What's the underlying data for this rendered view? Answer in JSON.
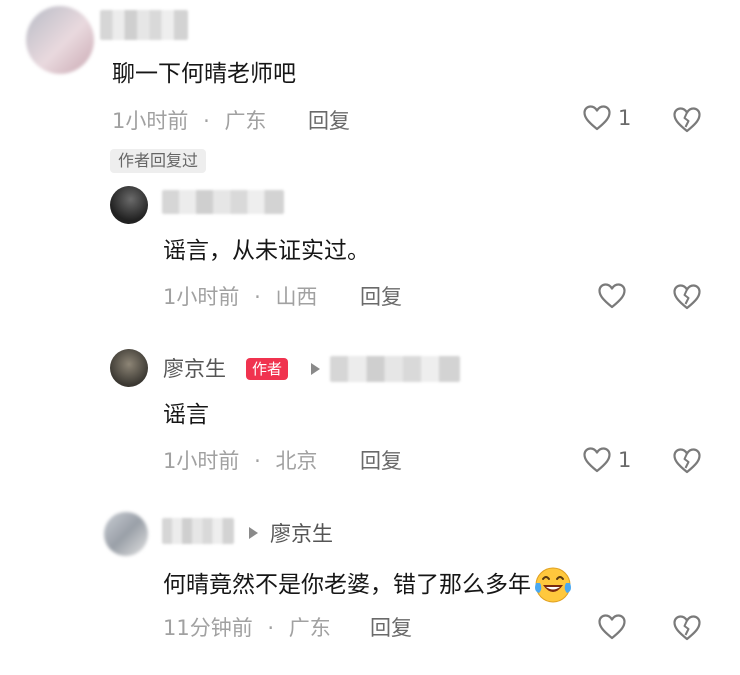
{
  "comments": [
    {
      "text": "聊一下何晴老师吧",
      "time": "1小时前",
      "location": "广东",
      "reply_label": "回复",
      "like_count": "1",
      "badge": "作者回复过"
    },
    {
      "text": "谣言，从未证实过。",
      "time": "1小时前",
      "location": "山西",
      "reply_label": "回复",
      "like_count": ""
    },
    {
      "author_name": "廖京生",
      "author_tag": "作者",
      "text": "谣言",
      "time": "1小时前",
      "location": "北京",
      "reply_label": "回复",
      "like_count": "1"
    },
    {
      "reply_to": "廖京生",
      "text": "何晴竟然不是你老婆，错了那么多年",
      "time": "11分钟前",
      "location": "广东",
      "reply_label": "回复",
      "like_count": ""
    }
  ],
  "meta_separator": "·",
  "icons": {
    "like": "heart-outline-icon",
    "dislike": "broken-heart-icon",
    "reply_arrow": "triangle-right-icon",
    "emoji": "laughing-crying-emoji-icon"
  },
  "colors": {
    "author_tag": "#f0334f",
    "meta_text": "#a1a1a1",
    "body_text": "#161616"
  }
}
